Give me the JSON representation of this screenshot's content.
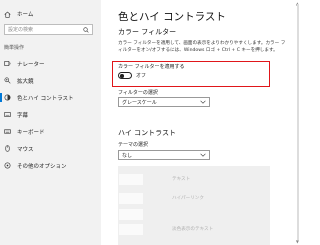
{
  "sidebar": {
    "home_label": "ホーム",
    "search_placeholder": "設定の検索",
    "section_label": "簡単操作",
    "items": [
      {
        "label": "ナレーター",
        "icon": "narrator-icon"
      },
      {
        "label": "拡大鏡",
        "icon": "magnifier-icon"
      },
      {
        "label": "色とハイ コントラスト",
        "icon": "color-contrast-icon",
        "selected": true
      },
      {
        "label": "字幕",
        "icon": "captions-icon"
      },
      {
        "label": "キーボード",
        "icon": "keyboard-icon"
      },
      {
        "label": "マウス",
        "icon": "mouse-icon"
      },
      {
        "label": "その他のオプション",
        "icon": "more-options-icon"
      }
    ]
  },
  "main": {
    "title": "色とハイ コントラスト",
    "color_filter": {
      "heading": "カラー フィルター",
      "description": "カラー フィルターを適用して、画面の表示をよりわかりやすくします。カラー フィルターをオン/オフするには、Windows ロゴ + Ctrl + C キーを押します。",
      "toggle_label": "カラー フィルターを適用する",
      "toggle_state": "オフ",
      "toggle_on": false,
      "select_label": "フィルターの選択",
      "select_value": "グレースケール"
    },
    "high_contrast": {
      "heading": "ハイ コントラスト",
      "theme_label": "テーマの選択",
      "theme_value": "なし",
      "swatches": [
        "テキスト",
        "ハイパーリンク",
        "",
        "淡色表示のテキスト"
      ]
    }
  },
  "colors": {
    "accent": "#0078d7",
    "highlight_box": "#e0161a",
    "sidebar_bg": "#f2f2f2"
  }
}
